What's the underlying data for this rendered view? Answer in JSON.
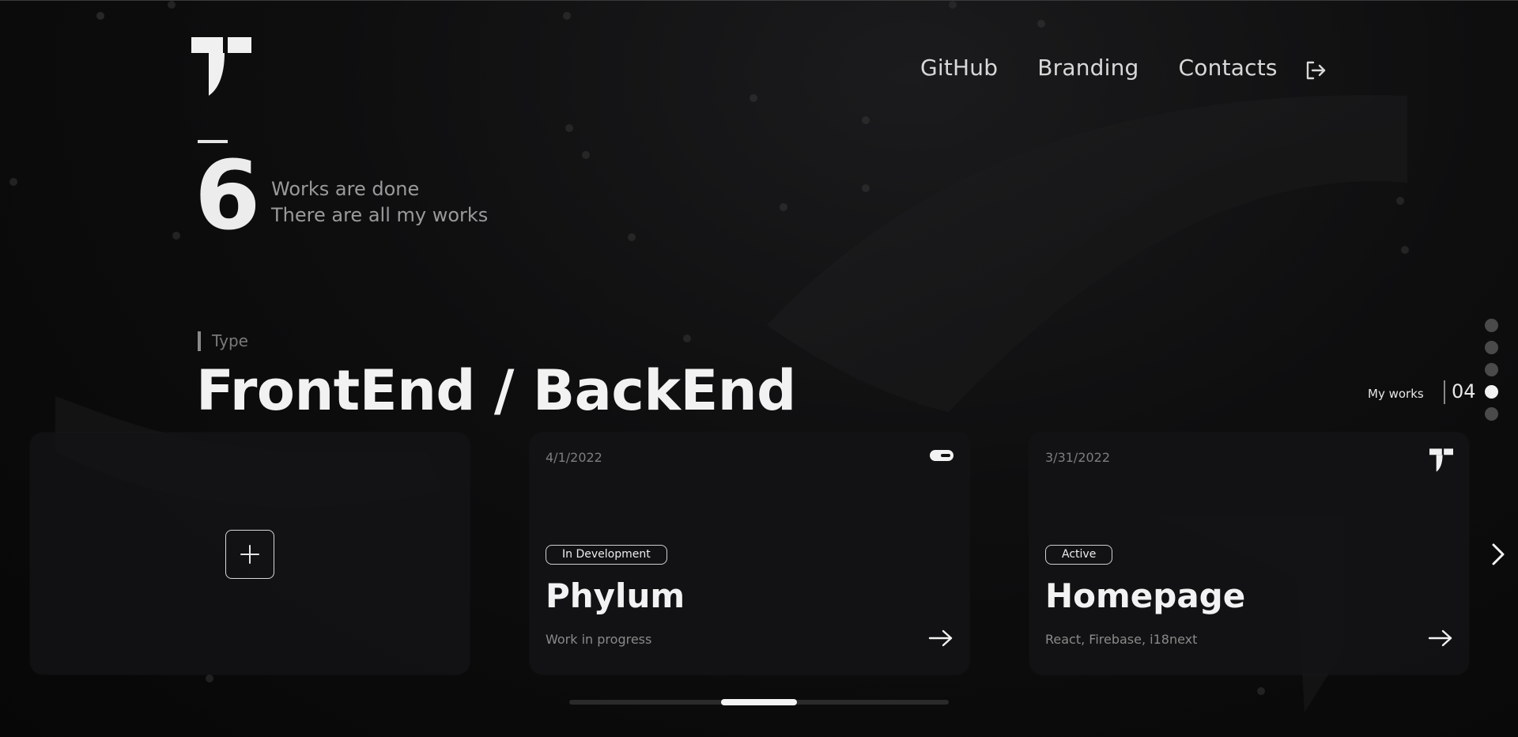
{
  "nav": {
    "items": [
      "GitHub",
      "Branding",
      "Contacts"
    ]
  },
  "works": {
    "count": "6",
    "line1": "Works are done",
    "line2": "There are all my works"
  },
  "type": {
    "label": "Type",
    "title": "FrontEnd / BackEnd"
  },
  "section": {
    "label": "My works",
    "number": "04",
    "dots": 5,
    "active_index": 3
  },
  "cards": [
    {
      "date": "4/1/2022",
      "badge": "In Development",
      "title": "Phylum",
      "description": "Work in progress",
      "icon": "pill-toggle-icon"
    },
    {
      "date": "3/31/2022",
      "badge": "Active",
      "title": "Homepage",
      "description": "React, Firebase, i18next",
      "icon": "t-logo-icon"
    }
  ],
  "colors": {
    "background": "#0b0b0c",
    "text": "#f2f2f2",
    "muted": "#8a8a8a"
  },
  "scroll": {
    "position_fraction": 0.4
  }
}
